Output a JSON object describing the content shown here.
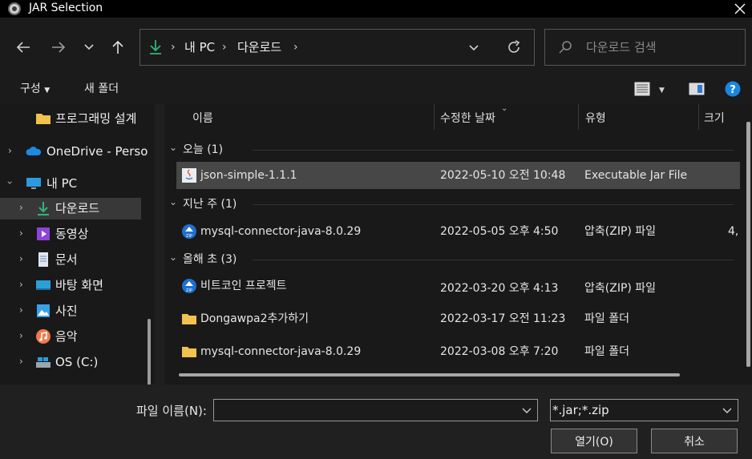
{
  "window": {
    "title": "JAR Selection"
  },
  "navigation": {
    "back_icon": "arrow-left-icon",
    "forward_icon": "arrow-right-icon",
    "recent_icon": "chevron-down-icon",
    "up_icon": "arrow-up-icon",
    "breadcrumb": [
      "내 PC",
      "다운로드"
    ],
    "search_placeholder": "다운로드 검색"
  },
  "toolbar": {
    "organize": "구성",
    "new_folder": "새 폴더"
  },
  "sidebar": {
    "items": [
      {
        "label": "프로그래밍 설계",
        "icon": "folder-icon"
      },
      {
        "label": "OneDrive - Perso",
        "icon": "onedrive-cloud-icon"
      },
      {
        "label": "내 PC",
        "icon": "computer-icon"
      },
      {
        "label": "다운로드",
        "icon": "download-icon"
      },
      {
        "label": "동영상",
        "icon": "videos-icon"
      },
      {
        "label": "문서",
        "icon": "documents-icon"
      },
      {
        "label": "바탕 화면",
        "icon": "desktop-icon"
      },
      {
        "label": "사진",
        "icon": "pictures-icon"
      },
      {
        "label": "음악",
        "icon": "music-icon"
      },
      {
        "label": "OS (C:)",
        "icon": "drive-icon"
      }
    ]
  },
  "columns": {
    "name": "이름",
    "modified": "수정한 날짜",
    "type": "유형",
    "size": "크기"
  },
  "groups": [
    {
      "label": "오늘 (1)",
      "files": [
        {
          "name": "json-simple-1.1.1",
          "modified": "2022-05-10 오전 10:48",
          "type": "Executable Jar File",
          "size": "",
          "icon": "java-jar-icon"
        }
      ]
    },
    {
      "label": "지난 주 (1)",
      "files": [
        {
          "name": "mysql-connector-java-8.0.29",
          "modified": "2022-05-05 오후 4:50",
          "type": "압축(ZIP) 파일",
          "size": "4,",
          "icon": "zip-file-icon"
        }
      ]
    },
    {
      "label": "올해 초 (3)",
      "files": [
        {
          "name": "비트코인 프로젝트",
          "modified": "2022-03-20 오후 4:13",
          "type": "압축(ZIP) 파일",
          "size": "",
          "icon": "zip-file-icon"
        },
        {
          "name": "Dongawpa2추가하기",
          "modified": "2022-03-17 오전 11:23",
          "type": "파일 폴더",
          "size": "",
          "icon": "folder-icon"
        },
        {
          "name": "mysql-connector-java-8.0.29",
          "modified": "2022-03-08 오후 7:20",
          "type": "파일 폴더",
          "size": "",
          "icon": "folder-icon"
        }
      ]
    }
  ],
  "footer": {
    "filename_label": "파일 이름(N):",
    "filename_value": "",
    "filetype_value": "*.jar;*.zip",
    "open_button": "열기(O)",
    "cancel_button": "취소"
  },
  "colors": {
    "accent": "#0078d4",
    "selection": "#474747",
    "folder": "#f2c14e",
    "download_green": "#2fb67c"
  }
}
